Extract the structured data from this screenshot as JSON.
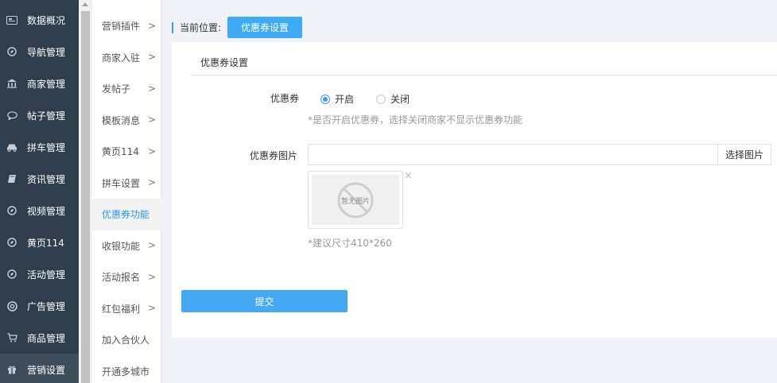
{
  "sidebar": {
    "items": [
      {
        "label": "数据概况",
        "icon": "dashboard-icon"
      },
      {
        "label": "导航管理",
        "icon": "compass-icon"
      },
      {
        "label": "商家管理",
        "icon": "bank-icon"
      },
      {
        "label": "帖子管理",
        "icon": "chat-icon"
      },
      {
        "label": "拼车管理",
        "icon": "car-icon"
      },
      {
        "label": "资讯管理",
        "icon": "book-icon"
      },
      {
        "label": "视频管理",
        "icon": "compass-icon"
      },
      {
        "label": "黄页114",
        "icon": "compass-icon"
      },
      {
        "label": "活动管理",
        "icon": "compass-icon"
      },
      {
        "label": "广告管理",
        "icon": "lifebuoy-icon"
      },
      {
        "label": "商品管理",
        "icon": "cart-icon"
      },
      {
        "label": "营销设置",
        "icon": "gift-icon"
      }
    ],
    "active_index": 11
  },
  "submenu": {
    "items": [
      {
        "label": "营销插件",
        "chevron": true
      },
      {
        "label": "商家入驻",
        "chevron": true
      },
      {
        "label": "发帖子",
        "chevron": true
      },
      {
        "label": "模板消息",
        "chevron": true
      },
      {
        "label": "黄页114",
        "chevron": true
      },
      {
        "label": "拼车设置",
        "chevron": true
      },
      {
        "label": "优惠券功能",
        "chevron": false
      },
      {
        "label": "收银功能",
        "chevron": true
      },
      {
        "label": "活动报名",
        "chevron": true
      },
      {
        "label": "红包福利",
        "chevron": true
      },
      {
        "label": "加入合伙人",
        "chevron": false
      },
      {
        "label": "开通多城市",
        "chevron": false
      }
    ],
    "active_index": 6,
    "chevron_glyph": ">"
  },
  "breadcrumb": {
    "label": "当前位置:",
    "current": "优惠券设置"
  },
  "panel": {
    "title": "优惠券设置",
    "coupon_label": "优惠券",
    "radio_on": "开启",
    "radio_off": "关闭",
    "radio_selected": "开启",
    "coupon_hint": "*是否开启优惠券，选择关闭商家不显示优惠券功能",
    "image_label": "优惠券图片",
    "image_value": "",
    "choose_image": "选择图片",
    "no_image_text": "暂无图片",
    "close_glyph": "×",
    "size_hint": "*建议尺寸410*260",
    "submit": "提交"
  },
  "colors": {
    "sidebar_bg": "#2f3e4c",
    "accent": "#3eaaf5",
    "active_sub": "#2a9ae6"
  }
}
